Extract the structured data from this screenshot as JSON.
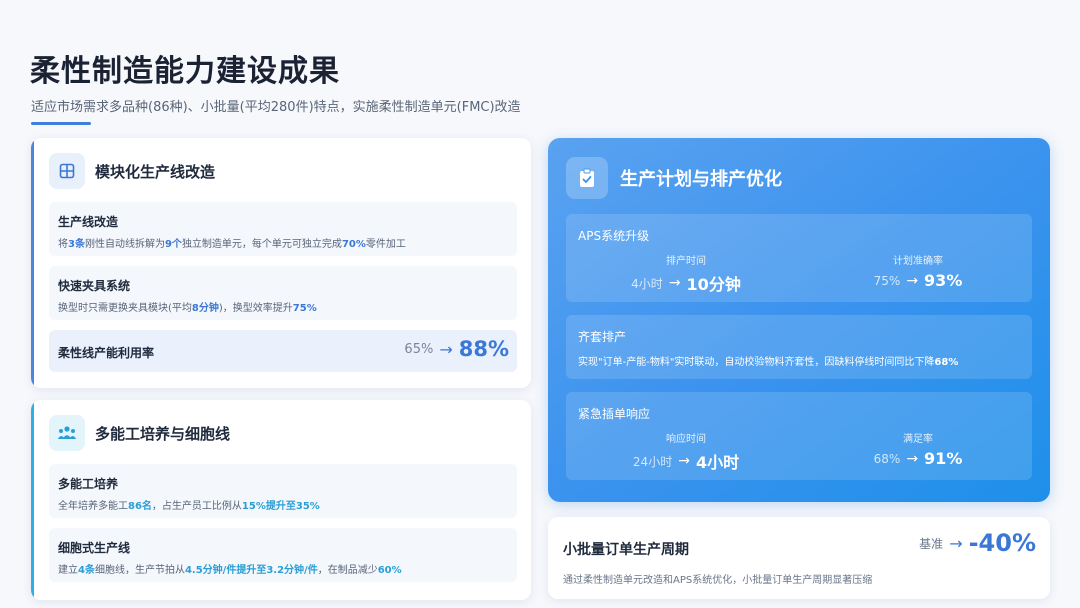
{
  "header": {
    "title": "柔性制造能力建设成果",
    "subtitle": "适应市场需求多品种(86种)、小批量(平均280件)特点，实施柔性制造单元(FMC)改造"
  },
  "modular": {
    "title": "模块化生产线改造",
    "icon": "grid-icon",
    "items": [
      {
        "title": "生产线改造",
        "desc": [
          "将",
          "3条",
          "刚性自动线拆解为",
          "9个",
          "独立制造单元，每个单元可独立完成",
          "70%",
          "零件加工"
        ]
      },
      {
        "title": "快速夹具系统",
        "desc": [
          "换型时只需更换夹具模块(平均",
          "8分钟",
          ")，换型效率提升",
          "75%",
          ""
        ]
      }
    ],
    "utilization": {
      "label": "柔性线产能利用率",
      "from": "65%",
      "to": "88%"
    }
  },
  "multi": {
    "title": "多能工培养与细胞线",
    "icon": "team-icon",
    "items": [
      {
        "title": "多能工培养",
        "desc": [
          "全年培养多能工",
          "86名",
          "，占生产员工比例从",
          "15%提升至35%",
          ""
        ]
      },
      {
        "title": "细胞式生产线",
        "desc": [
          "建立",
          "4条",
          "细胞线，生产节拍从",
          "4.5分钟/件提升至3.2分钟/件",
          "，在制品减少",
          "60%",
          ""
        ]
      }
    ]
  },
  "plan": {
    "title": "生产计划与排产优化",
    "icon": "clipboard-check-icon",
    "aps": {
      "title": "APS系统升级",
      "m1": {
        "label": "排产时间",
        "from": "4小时",
        "to": "10分钟"
      },
      "m2": {
        "label": "计划准确率",
        "from": "75%",
        "to": "93%"
      }
    },
    "kitting": {
      "title": "齐套排产",
      "desc": [
        "实现\"订单-产能-物料\"实时联动，自动校验物料齐套性，因缺料停线时间同比下降",
        "68%"
      ]
    },
    "urgent": {
      "title": "紧急插单响应",
      "m1": {
        "label": "响应时间",
        "from": "24小时",
        "to": "4小时"
      },
      "m2": {
        "label": "满足率",
        "from": "68%",
        "to": "91%"
      }
    }
  },
  "cycle": {
    "title": "小批量订单生产周期",
    "base": "基准",
    "value": "-40%",
    "desc": "通过柔性制造单元改造和APS系统优化，小批量订单生产周期显著压缩"
  },
  "colors": {
    "accent": "#3b78d6",
    "accent2": "#2a9fd6",
    "panel_blue": "#3b93ee"
  }
}
